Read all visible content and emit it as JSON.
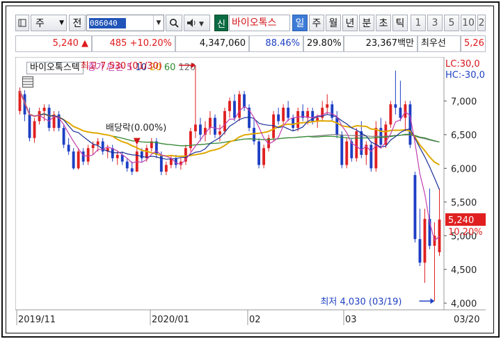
{
  "toolbar": {
    "market_label": "주",
    "code_label": "전",
    "stock_code": "086040",
    "badge_new": "신",
    "stock_name": "바이오톡스",
    "periods": [
      "일",
      "주",
      "월",
      "년",
      "분",
      "초",
      "틱"
    ],
    "active_period": "일",
    "intervals": [
      "1",
      "3",
      "5",
      "10",
      "2"
    ]
  },
  "quote": {
    "price": "5,240",
    "change": "485",
    "change_pct": "+10.20%",
    "volume": "4,347,060",
    "vol_ratio": "88.46%",
    "turnover": "29.80%",
    "amount": "23,367백만",
    "priority": "최우선",
    "last_partial": "5,26"
  },
  "legend": {
    "name": "바이오톡스텍",
    "ma_label": "종가 단순",
    "ma_periods": [
      "5",
      "10",
      "20",
      "60",
      "120"
    ],
    "lc": "LC:30,0",
    "hc": "HC:-30,0"
  },
  "chart_data": {
    "type": "candlestick",
    "x_labels": [
      "2019/11",
      "2020/01",
      "02",
      "03",
      "03/20"
    ],
    "y_ticks": [
      4000,
      4500,
      5000,
      5500,
      6000,
      6500,
      7000
    ],
    "ylim": [
      3900,
      7550
    ],
    "last_price_tag": "5,240",
    "last_pct_tag": "10.20%",
    "annotations": {
      "high": "최고 7,530 (01/30)",
      "low": "최저 4,030 (03/19)",
      "dividend": "배당락(0.00%)"
    },
    "colors": {
      "up": "#e02020",
      "down": "#1d3fc4",
      "ma5": "#c23fb0",
      "ma10": "#1a2f96",
      "ma20": "#e0a800",
      "ma60": "#2d8a2d",
      "ma120": "#777777"
    },
    "candles": [
      {
        "o": 6850,
        "h": 7200,
        "l": 6800,
        "c": 7150
      },
      {
        "o": 7100,
        "h": 7160,
        "l": 6700,
        "c": 6800
      },
      {
        "o": 6800,
        "h": 6900,
        "l": 6400,
        "c": 6450
      },
      {
        "o": 6450,
        "h": 6750,
        "l": 6380,
        "c": 6700
      },
      {
        "o": 6700,
        "h": 6900,
        "l": 6650,
        "c": 6850
      },
      {
        "o": 6850,
        "h": 6950,
        "l": 6700,
        "c": 6900
      },
      {
        "o": 6900,
        "h": 6950,
        "l": 6550,
        "c": 6600
      },
      {
        "o": 6600,
        "h": 6850,
        "l": 6550,
        "c": 6800
      },
      {
        "o": 6800,
        "h": 6850,
        "l": 6550,
        "c": 6600
      },
      {
        "o": 6600,
        "h": 6650,
        "l": 6300,
        "c": 6350
      },
      {
        "o": 6350,
        "h": 6450,
        "l": 6200,
        "c": 6250
      },
      {
        "o": 6250,
        "h": 6300,
        "l": 5980,
        "c": 6000
      },
      {
        "o": 6000,
        "h": 6300,
        "l": 5980,
        "c": 6250
      },
      {
        "o": 6250,
        "h": 6300,
        "l": 6050,
        "c": 6100
      },
      {
        "o": 6100,
        "h": 6350,
        "l": 6050,
        "c": 6300
      },
      {
        "o": 6300,
        "h": 6400,
        "l": 6200,
        "c": 6350
      },
      {
        "o": 6350,
        "h": 6450,
        "l": 6250,
        "c": 6400
      },
      {
        "o": 6400,
        "h": 6450,
        "l": 6200,
        "c": 6250
      },
      {
        "o": 6250,
        "h": 6350,
        "l": 6150,
        "c": 6300
      },
      {
        "o": 6300,
        "h": 6350,
        "l": 6100,
        "c": 6150
      },
      {
        "o": 6150,
        "h": 6250,
        "l": 6050,
        "c": 6200
      },
      {
        "o": 6200,
        "h": 6250,
        "l": 6050,
        "c": 6100
      },
      {
        "o": 6100,
        "h": 6150,
        "l": 5950,
        "c": 6000
      },
      {
        "o": 6000,
        "h": 6100,
        "l": 5900,
        "c": 5950
      },
      {
        "o": 5950,
        "h": 6350,
        "l": 5950,
        "c": 6250
      },
      {
        "o": 6250,
        "h": 6300,
        "l": 6100,
        "c": 6150
      },
      {
        "o": 6150,
        "h": 6350,
        "l": 6100,
        "c": 6300
      },
      {
        "o": 6300,
        "h": 6450,
        "l": 6250,
        "c": 6400
      },
      {
        "o": 6400,
        "h": 6450,
        "l": 6150,
        "c": 6200
      },
      {
        "o": 6200,
        "h": 6250,
        "l": 5900,
        "c": 5950
      },
      {
        "o": 5950,
        "h": 6100,
        "l": 5900,
        "c": 6050
      },
      {
        "o": 6050,
        "h": 6200,
        "l": 6000,
        "c": 6150
      },
      {
        "o": 6150,
        "h": 6200,
        "l": 6000,
        "c": 6050
      },
      {
        "o": 6050,
        "h": 6150,
        "l": 5980,
        "c": 6100
      },
      {
        "o": 6100,
        "h": 6350,
        "l": 6050,
        "c": 6300
      },
      {
        "o": 6300,
        "h": 6600,
        "l": 6250,
        "c": 6550
      },
      {
        "o": 6550,
        "h": 7530,
        "l": 6450,
        "c": 6650
      },
      {
        "o": 6650,
        "h": 6750,
        "l": 6400,
        "c": 6500
      },
      {
        "o": 6500,
        "h": 6700,
        "l": 6400,
        "c": 6600
      },
      {
        "o": 6600,
        "h": 6850,
        "l": 6500,
        "c": 6750
      },
      {
        "o": 6750,
        "h": 6800,
        "l": 6450,
        "c": 6500
      },
      {
        "o": 6500,
        "h": 6650,
        "l": 6400,
        "c": 6550
      },
      {
        "o": 6550,
        "h": 6900,
        "l": 6500,
        "c": 6850
      },
      {
        "o": 6850,
        "h": 7050,
        "l": 6750,
        "c": 7000
      },
      {
        "o": 7000,
        "h": 7100,
        "l": 6700,
        "c": 6750
      },
      {
        "o": 6750,
        "h": 7150,
        "l": 6700,
        "c": 7100
      },
      {
        "o": 7100,
        "h": 7150,
        "l": 6850,
        "c": 6900
      },
      {
        "o": 6900,
        "h": 6950,
        "l": 6550,
        "c": 6600
      },
      {
        "o": 6600,
        "h": 6750,
        "l": 6350,
        "c": 6400
      },
      {
        "o": 6400,
        "h": 6450,
        "l": 6000,
        "c": 6050
      },
      {
        "o": 6050,
        "h": 6350,
        "l": 6000,
        "c": 6300
      },
      {
        "o": 6300,
        "h": 6500,
        "l": 6250,
        "c": 6450
      },
      {
        "o": 6450,
        "h": 6850,
        "l": 6400,
        "c": 6800
      },
      {
        "o": 6800,
        "h": 6900,
        "l": 6650,
        "c": 6700
      },
      {
        "o": 6700,
        "h": 6950,
        "l": 6650,
        "c": 6900
      },
      {
        "o": 6900,
        "h": 7000,
        "l": 6700,
        "c": 6750
      },
      {
        "o": 6750,
        "h": 6800,
        "l": 6550,
        "c": 6600
      },
      {
        "o": 6600,
        "h": 6900,
        "l": 6550,
        "c": 6850
      },
      {
        "o": 6850,
        "h": 6950,
        "l": 6700,
        "c": 6750
      },
      {
        "o": 6750,
        "h": 6900,
        "l": 6650,
        "c": 6850
      },
      {
        "o": 6850,
        "h": 6900,
        "l": 6650,
        "c": 6700
      },
      {
        "o": 6700,
        "h": 6800,
        "l": 6600,
        "c": 6750
      },
      {
        "o": 6750,
        "h": 7000,
        "l": 6700,
        "c": 6900
      },
      {
        "o": 6900,
        "h": 7100,
        "l": 6800,
        "c": 6950
      },
      {
        "o": 6950,
        "h": 7000,
        "l": 6700,
        "c": 6750
      },
      {
        "o": 6750,
        "h": 6850,
        "l": 6450,
        "c": 6500
      },
      {
        "o": 6500,
        "h": 6550,
        "l": 6000,
        "c": 6050
      },
      {
        "o": 6050,
        "h": 6450,
        "l": 6000,
        "c": 6400
      },
      {
        "o": 6400,
        "h": 6450,
        "l": 6100,
        "c": 6150
      },
      {
        "o": 6150,
        "h": 6600,
        "l": 6100,
        "c": 6550
      },
      {
        "o": 6550,
        "h": 6700,
        "l": 6150,
        "c": 6200
      },
      {
        "o": 6200,
        "h": 6400,
        "l": 6050,
        "c": 6350
      },
      {
        "o": 6350,
        "h": 6400,
        "l": 5950,
        "c": 6000
      },
      {
        "o": 6000,
        "h": 6700,
        "l": 5950,
        "c": 6600
      },
      {
        "o": 6600,
        "h": 6750,
        "l": 6300,
        "c": 6350
      },
      {
        "o": 6350,
        "h": 6700,
        "l": 6300,
        "c": 6650
      },
      {
        "o": 6650,
        "h": 7000,
        "l": 6600,
        "c": 6950
      },
      {
        "o": 6950,
        "h": 7450,
        "l": 6800,
        "c": 6900
      },
      {
        "o": 6900,
        "h": 7300,
        "l": 6700,
        "c": 6750
      },
      {
        "o": 6750,
        "h": 7000,
        "l": 6550,
        "c": 6950
      },
      {
        "o": 6950,
        "h": 7000,
        "l": 6300,
        "c": 6350
      },
      {
        "o": 5900,
        "h": 5950,
        "l": 4900,
        "c": 4950
      },
      {
        "o": 4950,
        "h": 5400,
        "l": 4550,
        "c": 4600
      },
      {
        "o": 4600,
        "h": 5400,
        "l": 4300,
        "c": 5250
      },
      {
        "o": 5250,
        "h": 5700,
        "l": 4800,
        "c": 4850
      },
      {
        "o": 4850,
        "h": 5200,
        "l": 4030,
        "c": 5000
      },
      {
        "o": 4755,
        "h": 5700,
        "l": 4700,
        "c": 5240
      }
    ]
  }
}
